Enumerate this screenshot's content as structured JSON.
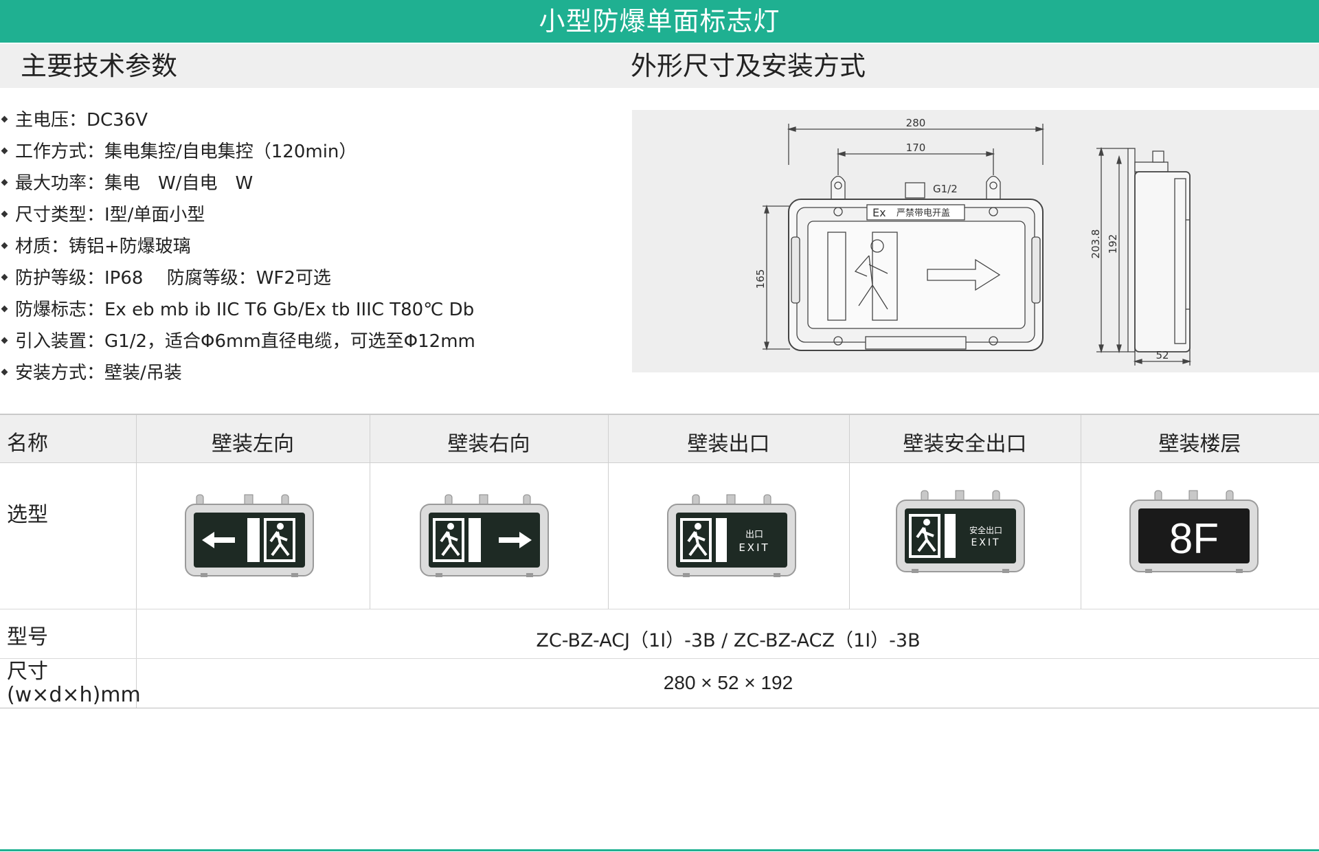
{
  "header": {
    "title": "小型防爆单面标志灯"
  },
  "sections": {
    "left_title": "主要技术参数",
    "right_title": "外形尺寸及安装方式"
  },
  "specs": [
    "主电压：DC36V",
    "工作方式：集电集控/自电集控（120min）",
    "最大功率：集电　W/自电　W",
    "尺寸类型：Ⅰ型/单面小型",
    "材质：铸铝+防爆玻璃",
    "防护等级：IP68　 防腐等级：WF2可选",
    "防爆标志：Ex eb mb ib IIC T6 Gb/Ex tb IIIC T80℃ Db",
    "引入装置：G1/2，适合Φ6mm直径电缆，可选至Φ12mm",
    "安装方式：壁装/吊装"
  ],
  "drawing": {
    "dim_width": "280",
    "dim_mount": "170",
    "dim_thread": "G1/2",
    "dim_height_left": "165",
    "dim_height_total": "203.8",
    "dim_height_body": "192",
    "dim_depth": "52",
    "badge_ex": "Ex",
    "badge_text": "严禁带电开盖"
  },
  "table": {
    "header_label": "名称",
    "columns": [
      "壁装左向",
      "壁装右向",
      "壁装出口",
      "壁装安全出口",
      "壁装楼层"
    ],
    "row_selection_label": "选型",
    "row_model_label": "型号",
    "model_value": "ZC-BZ-ACJ（1Ⅰ）-3B / ZC-BZ-ACZ（1Ⅰ）-3B",
    "row_size_label_1": "尺寸",
    "row_size_label_2": "(w×d×h)mm",
    "size_value": "280 × 52 × 192"
  },
  "signs": {
    "exit_cn": "出口",
    "exit_en": "EXIT",
    "safe_exit_cn": "安全出口",
    "floor": "8F"
  },
  "colors": {
    "accent": "#1fb091",
    "panel": "#efefef",
    "sign_face": "#1e2a24",
    "sign_symbol": "#ffffff"
  }
}
